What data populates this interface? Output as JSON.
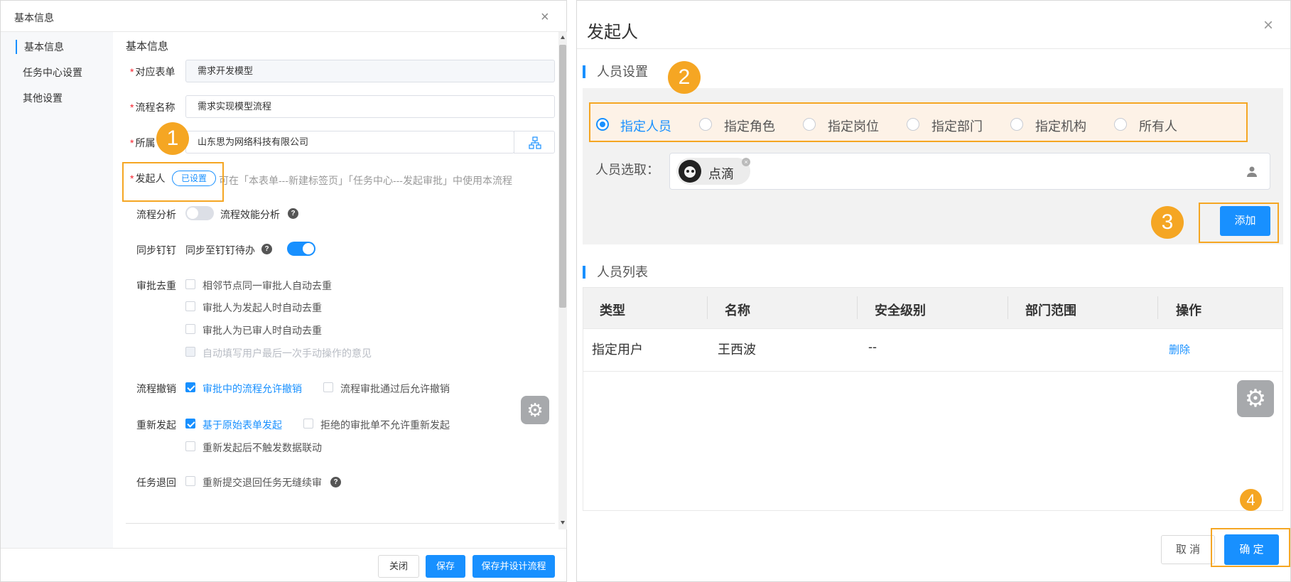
{
  "left": {
    "title": "基本信息",
    "side_items": [
      "基本信息",
      "任务中心设置",
      "其他设置"
    ],
    "section_title": "基本信息",
    "form": {
      "form_label": "对应表单",
      "form_value": "需求开发模型",
      "flow_label": "流程名称",
      "flow_value": "需求实现模型流程",
      "org_label": "所属",
      "org_value": "山东思为网络科技有限公司",
      "initiator_label": "发起人",
      "initiator_tag": "已设置",
      "initiator_desc": "可在「本表单---新建标签页」「任务中心---发起审批」中使用本流程",
      "analysis_label": "流程分析",
      "analysis_text": "流程效能分析",
      "sync_label": "同步钉钉",
      "sync_text": "同步至钉钉待办",
      "dedup_label": "审批去重",
      "dedup_options": [
        "相邻节点同一审批人自动去重",
        "审批人为发起人时自动去重",
        "审批人为已审人时自动去重",
        "自动填写用户最后一次手动操作的意见"
      ],
      "revoke_label": "流程撤销",
      "revoke_options": [
        "审批中的流程允许撤销",
        "流程审批通过后允许撤销"
      ],
      "restart_label": "重新发起",
      "restart_options": [
        "基于原始表单发起",
        "拒绝的审批单不允许重新发起",
        "重新发起后不触发数据联动"
      ],
      "return_label": "任务退回",
      "return_option": "重新提交退回任务无缝续审"
    },
    "buttons": {
      "close": "关闭",
      "save": "保存",
      "save_design": "保存并设计流程"
    }
  },
  "right": {
    "title": "发起人",
    "person_section": "人员设置",
    "radio_options": [
      "指定人员",
      "指定角色",
      "指定岗位",
      "指定部门",
      "指定机构",
      "所有人"
    ],
    "select_label": "人员选取：",
    "chip_name": "点滴",
    "add_button": "添加",
    "list_section": "人员列表",
    "table": {
      "headers": [
        "类型",
        "名称",
        "安全级别",
        "部门范围",
        "操作"
      ],
      "row": [
        "指定用户",
        "王西波",
        "--",
        "",
        "删除"
      ]
    },
    "cancel_button": "取 消",
    "ok_button": "确 定"
  },
  "badges": [
    "1",
    "2",
    "3",
    "4"
  ],
  "colors": {
    "accent": "#1890ff",
    "highlight": "#f5a623"
  },
  "toggles": {
    "analysis_on": false,
    "sync_on": true
  }
}
